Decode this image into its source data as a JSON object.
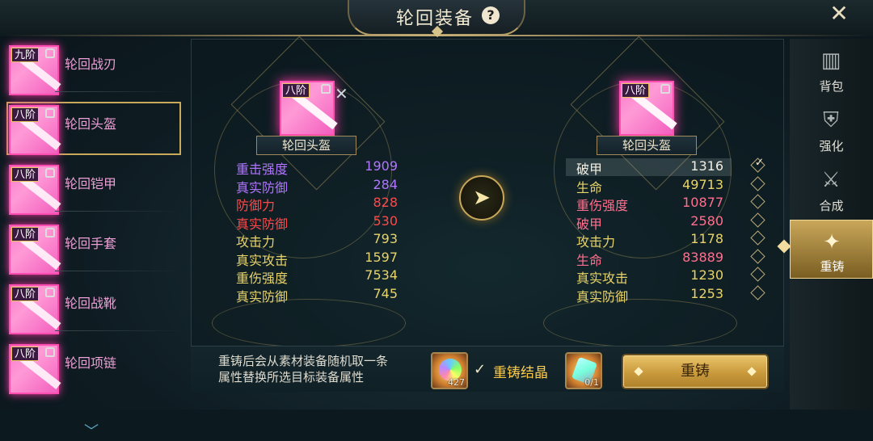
{
  "header": {
    "title": "轮回装备",
    "help_icon": "question-icon",
    "close_icon": "close-icon"
  },
  "left_list": {
    "items": [
      {
        "badge": "九阶",
        "name": "轮回战刃"
      },
      {
        "badge": "八阶",
        "name": "轮回头盔"
      },
      {
        "badge": "八阶",
        "name": "轮回铠甲"
      },
      {
        "badge": "八阶",
        "name": "轮回手套"
      },
      {
        "badge": "八阶",
        "name": "轮回战靴"
      },
      {
        "badge": "八阶",
        "name": "轮回项链"
      }
    ],
    "selected_index": 1
  },
  "left_equip": {
    "badge": "八阶",
    "name": "轮回头盔",
    "stats": [
      {
        "k": "重击强度",
        "v": "1909",
        "color": "purple"
      },
      {
        "k": "真实防御",
        "v": "284",
        "color": "purple"
      },
      {
        "k": "防御力",
        "v": "828",
        "color": "red"
      },
      {
        "k": "真实防御",
        "v": "530",
        "color": "red"
      },
      {
        "k": "攻击力",
        "v": "793",
        "color": "yellow"
      },
      {
        "k": "真实攻击",
        "v": "1597",
        "color": "yellow"
      },
      {
        "k": "重伤强度",
        "v": "7534",
        "color": "yellow"
      },
      {
        "k": "真实防御",
        "v": "745",
        "color": "yellow"
      }
    ]
  },
  "right_equip": {
    "badge": "八阶",
    "name": "轮回头盔",
    "stats": [
      {
        "k": "破甲",
        "v": "1316",
        "color": "white"
      },
      {
        "k": "生命",
        "v": "49713",
        "color": "yellow"
      },
      {
        "k": "重伤强度",
        "v": "10877",
        "color": "pink"
      },
      {
        "k": "破甲",
        "v": "2580",
        "color": "pink"
      },
      {
        "k": "攻击力",
        "v": "1178",
        "color": "yellow"
      },
      {
        "k": "生命",
        "v": "83889",
        "color": "pink"
      },
      {
        "k": "真实攻击",
        "v": "1230",
        "color": "yellow"
      },
      {
        "k": "真实防御",
        "v": "1253",
        "color": "yellow"
      }
    ],
    "checked": [
      true,
      false,
      false,
      false,
      false,
      false,
      false,
      false
    ]
  },
  "bottom": {
    "info_line1": "重铸后会从素材装备随机取一条",
    "info_line2": "属性替换所选目标装备属性",
    "material1_count": "427",
    "material_name": "重铸结晶",
    "material2_count": "0/1",
    "recast_label": "重铸"
  },
  "tabs": [
    {
      "label": "背包",
      "icon": "backpack-icon"
    },
    {
      "label": "强化",
      "icon": "armor-icon"
    },
    {
      "label": "合成",
      "icon": "sword-icon"
    },
    {
      "label": "重铸",
      "icon": "compass-star-icon"
    }
  ],
  "active_tab": 3,
  "colors": {
    "purple": "#b175ff",
    "red": "#ff4848",
    "yellow": "#e8d36a",
    "white": "#f2efe3",
    "pink": "#ff6f8e",
    "gold": "#c9a75a"
  }
}
